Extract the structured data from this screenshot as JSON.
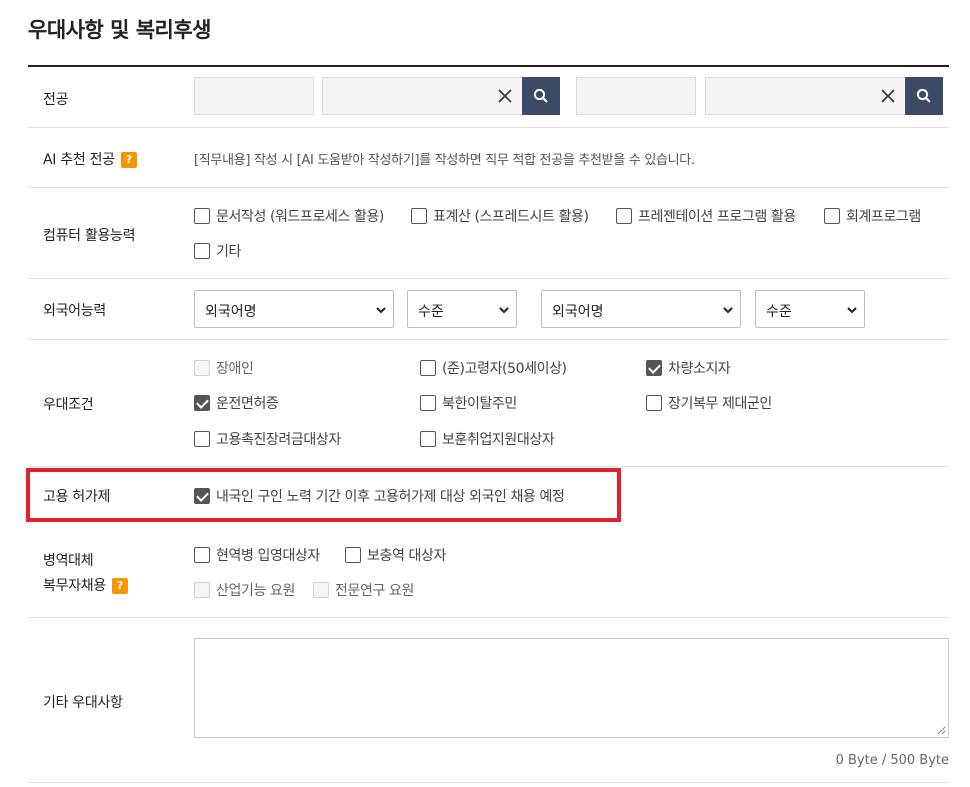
{
  "section": {
    "title": "우대사항 및 복리후생"
  },
  "major": {
    "label": "전공"
  },
  "ai": {
    "label": "AI 추천 전공",
    "badge": "?",
    "help": "[직무내용] 작성 시 [AI 도움받아 작성하기]를 작성하면 직무 적합 전공을 추천받을 수 있습니다."
  },
  "computer": {
    "label": "컴퓨터 활용능력",
    "options": [
      {
        "label": "문서작성 (워드프로세스 활용)",
        "checked": false
      },
      {
        "label": "표계산 (스프레드시트 활용)",
        "checked": false
      },
      {
        "label": "프레젠테이션 프로그램 활용",
        "checked": false
      },
      {
        "label": "회계프로그램",
        "checked": false
      },
      {
        "label": "기타",
        "checked": false
      }
    ]
  },
  "language": {
    "label": "외국어능력",
    "lang1": "외국어명",
    "level1": "수준",
    "lang2": "외국어명",
    "level2": "수준"
  },
  "preference": {
    "label": "우대조건",
    "options": [
      {
        "label": "장애인",
        "checked": false,
        "disabled": true
      },
      {
        "label": "(준)고령자(50세이상)",
        "checked": false,
        "disabled": false
      },
      {
        "label": "차량소지자",
        "checked": true,
        "disabled": false
      },
      {
        "label": "운전면허증",
        "checked": true,
        "disabled": false
      },
      {
        "label": "북한이탈주민",
        "checked": false,
        "disabled": false
      },
      {
        "label": "장기복무 제대군인",
        "checked": false,
        "disabled": false
      },
      {
        "label": "고용촉진장려금대상자",
        "checked": false,
        "disabled": false
      },
      {
        "label": "보훈취업지원대상자",
        "checked": false,
        "disabled": false
      }
    ]
  },
  "permit": {
    "label": "고용 허가제",
    "option": {
      "label": "내국인 구인 노력 기간 이후 고용허가제 대상 외국인 채용 예정",
      "checked": true
    }
  },
  "military": {
    "label_line1": "병역대체",
    "label_line2": "복무자채용",
    "badge": "?",
    "options": [
      {
        "label": "현역병 입영대상자",
        "checked": false,
        "disabled": false
      },
      {
        "label": "보충역 대상자",
        "checked": false,
        "disabled": false
      },
      {
        "label": "산업기능 요원",
        "checked": false,
        "disabled": true
      },
      {
        "label": "전문연구 요원",
        "checked": false,
        "disabled": true
      }
    ]
  },
  "other": {
    "label": "기타 우대사항",
    "value": "",
    "byte_count": "0 Byte / 500 Byte"
  },
  "colors": {
    "accent_button": "#3c4a66",
    "help_badge": "#f39800",
    "highlight": "#e0202a"
  }
}
